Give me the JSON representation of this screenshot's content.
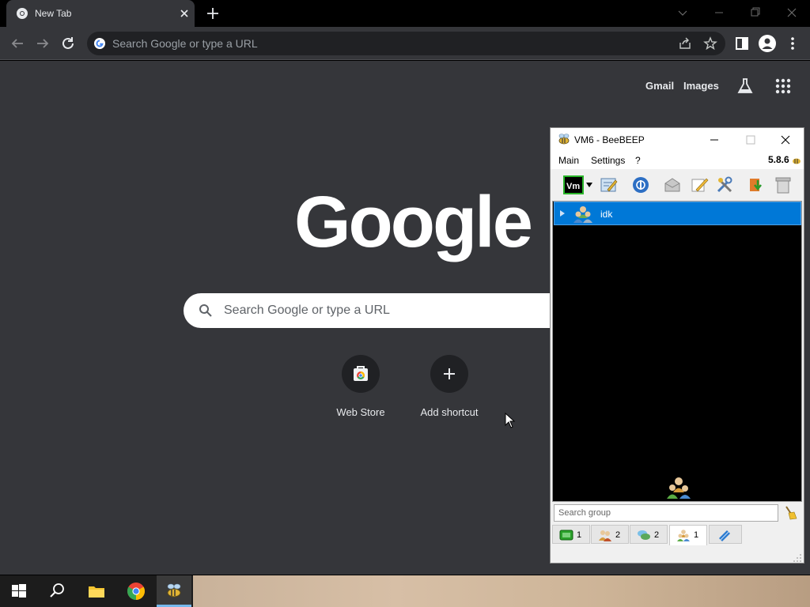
{
  "browser": {
    "tab_title": "New Tab",
    "omnibox_placeholder": "Search Google or type a URL"
  },
  "ntp": {
    "links": {
      "gmail": "Gmail",
      "images": "Images"
    },
    "logo_text": "Google",
    "search_placeholder": "Search Google or type a URL",
    "shortcuts": [
      {
        "label": "Web Store",
        "icon": "web-store-icon"
      },
      {
        "label": "Add shortcut",
        "icon": "plus-icon"
      }
    ]
  },
  "beebeep": {
    "title": "VM6 - BeeBEEP",
    "version": "5.8.6",
    "menu": [
      "Main",
      "Settings",
      "?"
    ],
    "groups": [
      {
        "name": "idk"
      }
    ],
    "search_placeholder": "Search group",
    "tabs": [
      {
        "icon": "users-online-icon",
        "count": "1"
      },
      {
        "icon": "group-icon",
        "count": "2"
      },
      {
        "icon": "chat-icon",
        "count": "2"
      },
      {
        "icon": "groups-icon",
        "count": "1",
        "selected": true
      },
      {
        "icon": "share-icon",
        "count": ""
      }
    ],
    "status_color": "#0078d7"
  },
  "taskbar": {
    "items": [
      "start-icon",
      "search-icon",
      "file-explorer-icon",
      "chrome-icon",
      "beebeep-icon"
    ]
  },
  "colors": {
    "chrome_bg": "#35363a",
    "selection_blue": "#0078d7"
  }
}
